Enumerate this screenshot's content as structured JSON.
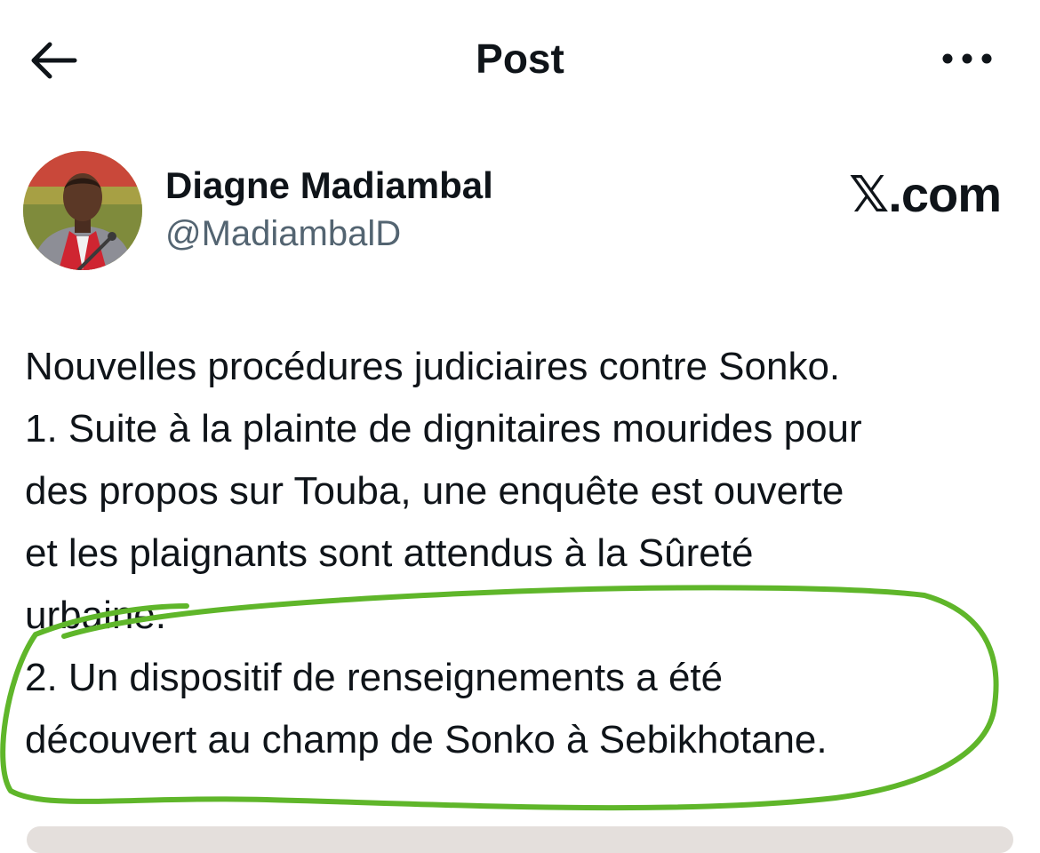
{
  "header": {
    "title": "Post",
    "back_icon": "arrow-left-icon",
    "more_icon": "more-horizontal-icon"
  },
  "author": {
    "display_name": "Diagne Madiambal",
    "handle": "@MadiambalD",
    "avatar": "profile-photo"
  },
  "watermark": {
    "text": "𝕏.com"
  },
  "post": {
    "lines": [
      "Nouvelles procédures judiciaires contre Sonko.",
      "1. Suite à la plainte de dignitaires mourides pour",
      "des propos sur Touba, une enquête est ouverte",
      "et les plaignants sont attendus à la Sûreté",
      "urbaine.",
      "2. Un dispositif de renseignements a été",
      "découvert au champ de Sonko à Sebikhotane."
    ]
  },
  "colors": {
    "text": "#0f1419",
    "secondary_text": "#536471",
    "annotation_stroke": "#5fb62a",
    "background": "#ffffff"
  }
}
